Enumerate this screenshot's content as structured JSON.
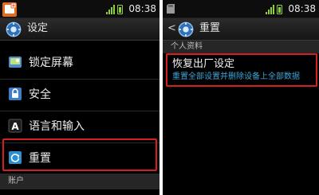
{
  "status_bar": {
    "time": "08:38"
  },
  "left_screen": {
    "title": "设定",
    "items": [
      {
        "label": "锁定屏幕",
        "icon": "lock-screen-icon"
      },
      {
        "label": "安全",
        "icon": "padlock-icon"
      },
      {
        "label": "语言和输入",
        "icon": "letter-a-icon"
      },
      {
        "label": "重置",
        "icon": "reset-icon",
        "highlighted": true
      }
    ],
    "section_footer": "账户"
  },
  "right_screen": {
    "title": "重置",
    "section_header": "个人资料",
    "factory_reset": {
      "title": "恢复出厂设定",
      "description": "重置全部设置并删除设备上全部数据"
    }
  },
  "colors": {
    "highlight_border": "#d41f1f",
    "accent_text": "#3ea6d8",
    "status_green": "#8ccf3a"
  }
}
